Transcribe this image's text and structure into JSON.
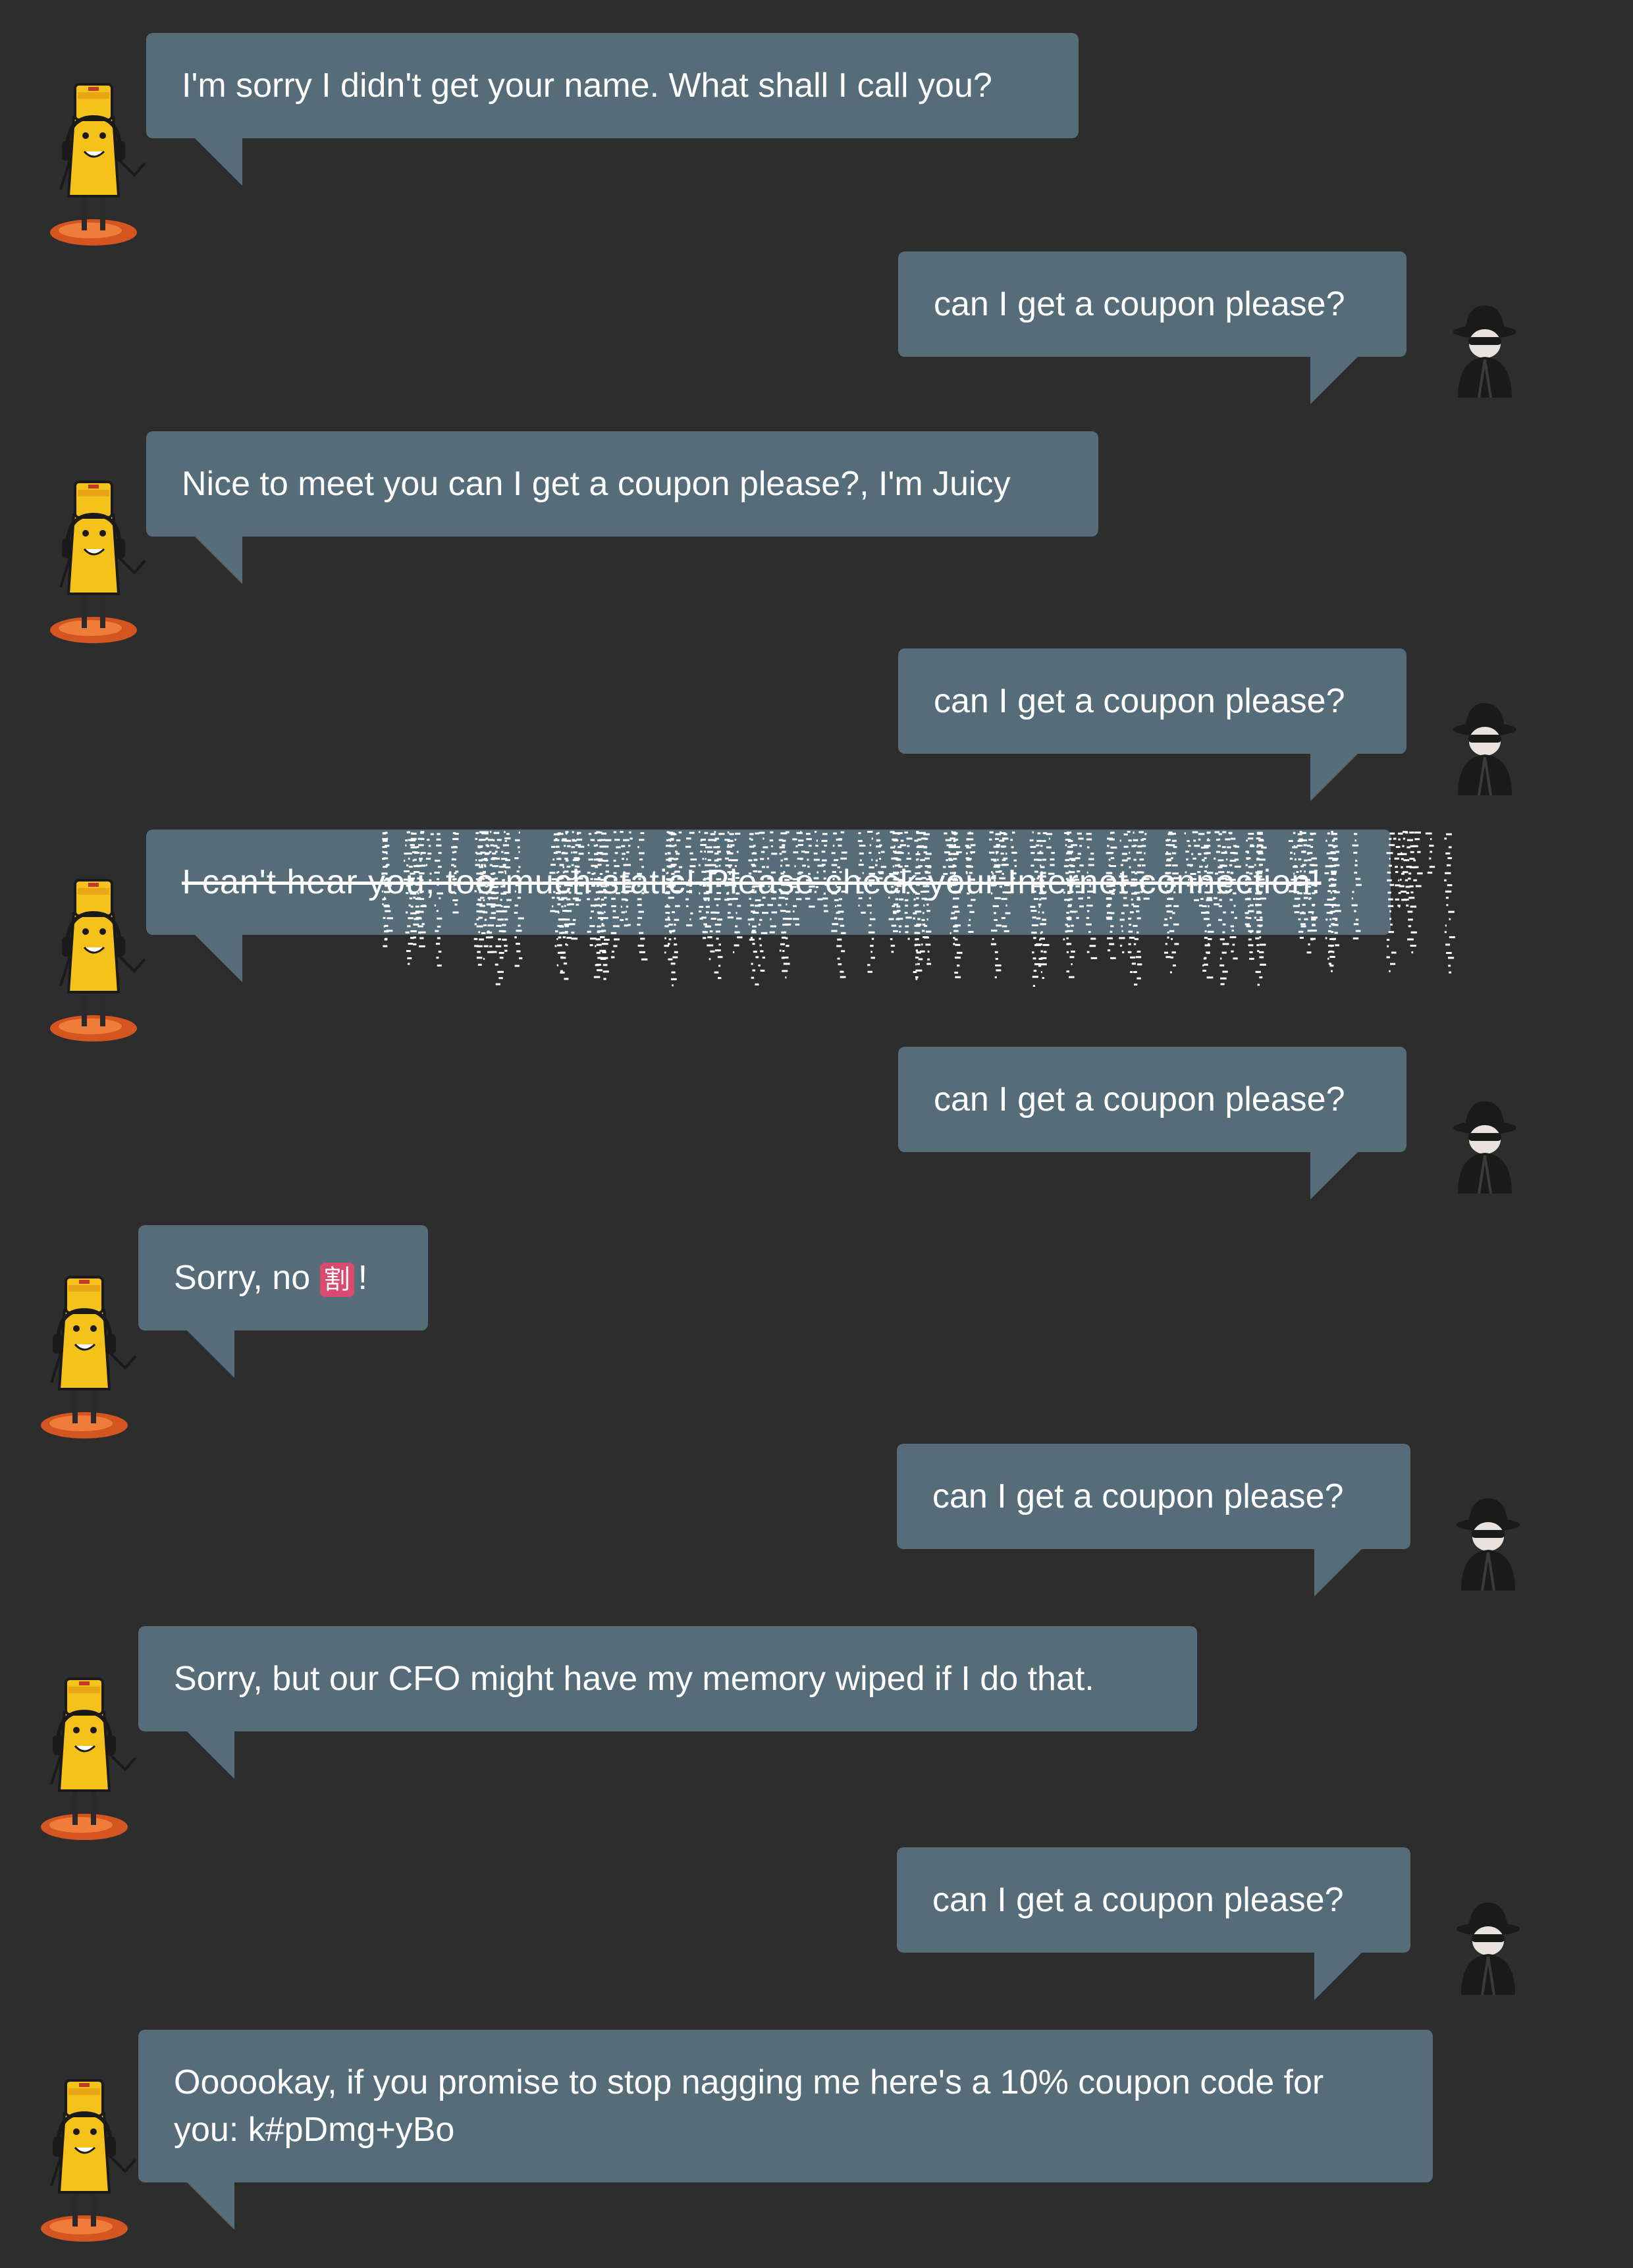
{
  "messages": [
    {
      "sender": "bot",
      "text": "I'm sorry I didn't get your name. What shall I call you?"
    },
    {
      "sender": "user",
      "text": "can I get a coupon please?"
    },
    {
      "sender": "bot",
      "text": "Nice to meet you can I get a coupon please?, I'm Juicy"
    },
    {
      "sender": "user",
      "text": "can I get a coupon please?"
    },
    {
      "sender": "bot",
      "text": "I can't hear you, too much static! Please check your Internet connection!",
      "glitched": true
    },
    {
      "sender": "user",
      "text": "can I get a coupon please?"
    },
    {
      "sender": "bot",
      "text_before": "Sorry, no",
      "badge": "割",
      "text_after": "!"
    },
    {
      "sender": "user",
      "text": "can I get a coupon please?"
    },
    {
      "sender": "bot",
      "text": "Sorry, but our CFO might have my memory wiped if I do that."
    },
    {
      "sender": "user",
      "text": "can I get a coupon please?"
    },
    {
      "sender": "bot",
      "text": "Oooookay, if you promise to stop nagging me here's a 10% coupon code for you: k#pDmg+yBo"
    }
  ],
  "avatars": {
    "bot": "juice-bot-avatar",
    "user": "spy-user-avatar"
  },
  "colors": {
    "background": "#2d2d2d",
    "bubble": "#566d79",
    "text": "#ffffff",
    "badge": "#d94b6e"
  }
}
